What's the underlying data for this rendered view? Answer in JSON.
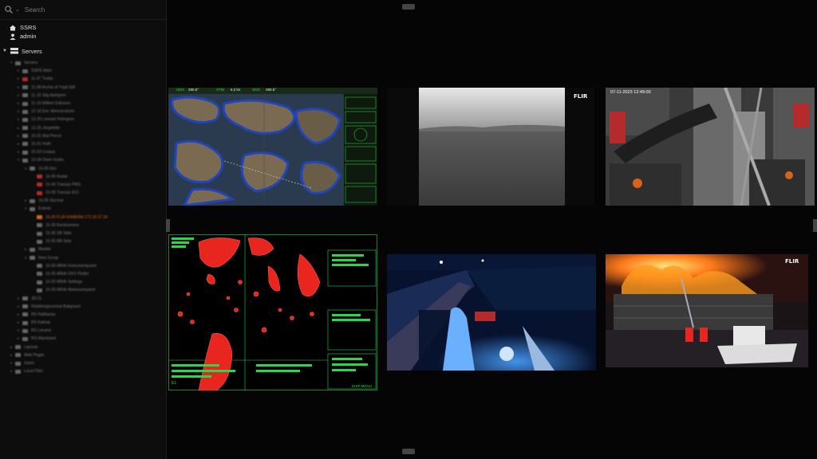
{
  "sidebar": {
    "search_placeholder": "Search",
    "site": "SSRS",
    "user": "admin",
    "servers_label": "Servers",
    "tree": [
      {
        "label": "Servers",
        "indent": 1,
        "exp": "▾"
      },
      {
        "label": "SSRS Main",
        "indent": 2,
        "exp": "▸"
      },
      {
        "label": "11-07 Tostta",
        "indent": 2,
        "exp": "▸",
        "red": true
      },
      {
        "label": "11-08 Ancha of Yrgal fjäll",
        "indent": 2,
        "exp": "▸"
      },
      {
        "label": "11-15 Stig Apelgren",
        "indent": 2,
        "exp": "▸"
      },
      {
        "label": "11-19 Willem Eriksson",
        "indent": 2,
        "exp": "▸"
      },
      {
        "label": "12-16 Eric Wennerström",
        "indent": 2,
        "exp": "▸"
      },
      {
        "label": "12-20 Lennart Holmgren",
        "indent": 2,
        "exp": "▸"
      },
      {
        "label": "12-25 Jürgebitte",
        "indent": 2,
        "exp": "▸"
      },
      {
        "label": "15-01 Mat Pierce",
        "indent": 2,
        "exp": "▸"
      },
      {
        "label": "15-01 Hoth",
        "indent": 2,
        "exp": "▸"
      },
      {
        "label": "15-03 Corpus",
        "indent": 2,
        "exp": "▸"
      },
      {
        "label": "15-04 Osen Godin",
        "indent": 2,
        "exp": "▾"
      },
      {
        "label": "15-05 Ekn",
        "indent": 3,
        "exp": "▾"
      },
      {
        "label": "15-05 Radar",
        "indent": 4,
        "exp": "",
        "red": true
      },
      {
        "label": "15-05 Transas PMS",
        "indent": 4,
        "exp": "",
        "red": true
      },
      {
        "label": "15-05 Transas ECI",
        "indent": 4,
        "exp": "",
        "red": true
      },
      {
        "label": "15-05 Styrmar",
        "indent": 3,
        "exp": "▸"
      },
      {
        "label": "Exterör",
        "indent": 3,
        "exp": "▾"
      },
      {
        "label": "15-05 FLIR KAMERA 172.16.57.24",
        "indent": 4,
        "exp": "",
        "sel": true
      },
      {
        "label": "15-05 Backkamera",
        "indent": 4,
        "exp": ""
      },
      {
        "label": "15-05 SB Sida",
        "indent": 4,
        "exp": ""
      },
      {
        "label": "15-05 BB Sida",
        "indent": 4,
        "exp": ""
      },
      {
        "label": "Maskin",
        "indent": 3,
        "exp": "▸"
      },
      {
        "label": "New Group",
        "indent": 3,
        "exp": "▾"
      },
      {
        "label": "15-05 MRAI Instrumentpanel",
        "indent": 4,
        "exp": ""
      },
      {
        "label": "15-05 MRAI DVO Plotter",
        "indent": 4,
        "exp": ""
      },
      {
        "label": "15-05 MRAI Settings",
        "indent": 4,
        "exp": ""
      },
      {
        "label": "15-05 MRAI Maneuverpanel",
        "indent": 4,
        "exp": ""
      },
      {
        "label": "JECS",
        "indent": 2,
        "exp": "▸"
      },
      {
        "label": "Räddningscentral Bakgrund",
        "indent": 2,
        "exp": "▸"
      },
      {
        "label": "RS Hallbacka",
        "indent": 2,
        "exp": "▸"
      },
      {
        "label": "RS Kalmar",
        "indent": 2,
        "exp": "▸"
      },
      {
        "label": "RS Lerums",
        "indent": 2,
        "exp": "▸"
      },
      {
        "label": "RS Marstrand",
        "indent": 2,
        "exp": "▸"
      },
      {
        "label": "Layouts",
        "indent": 1,
        "exp": "▸"
      },
      {
        "label": "Web Pages",
        "indent": 1,
        "exp": "▸"
      },
      {
        "label": "Users",
        "indent": 1,
        "exp": "▸"
      },
      {
        "label": "Local Files",
        "indent": 1,
        "exp": "▸"
      }
    ]
  },
  "tiles": {
    "ecdis": {
      "hdg": "HDG",
      "hdg_val": "280.5°",
      "stw": "STW",
      "stw_val": "6.2 kn",
      "sog": "SOG",
      "sog_val": "280.5°"
    },
    "thermal": {
      "logo": "FLIR"
    },
    "engine": {
      "timestamp": "07-11-2023 12:49:00"
    },
    "radar": {
      "corner": "E1",
      "menu": "DISP MENU"
    },
    "harbor": {},
    "fire": {
      "logo": "FLIR"
    }
  },
  "colors": {
    "accent_selected": "#d8621a",
    "radar_green": "#26d84a",
    "radar_echo": "#e8261f"
  }
}
